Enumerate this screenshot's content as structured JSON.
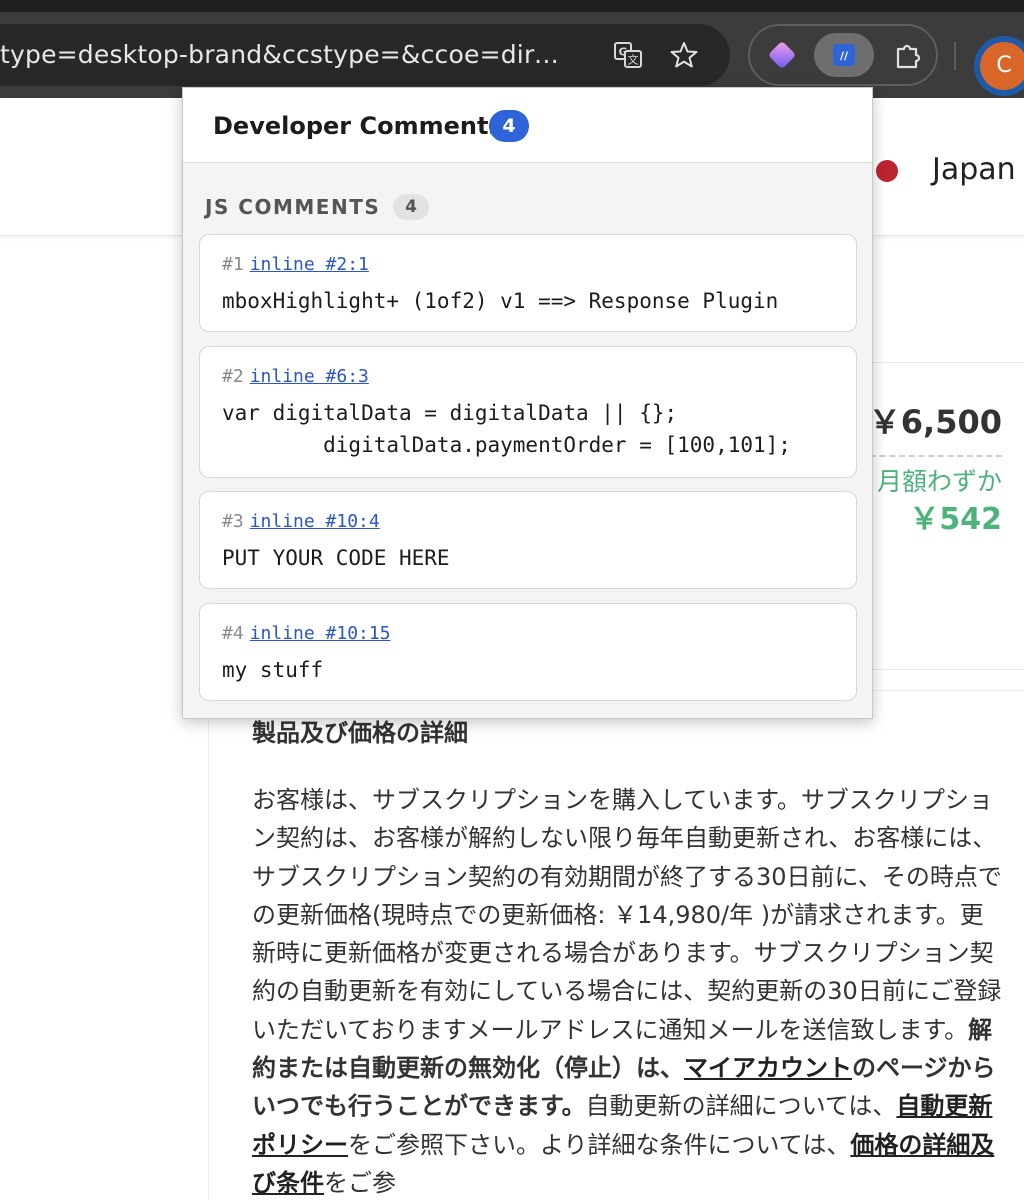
{
  "browser": {
    "url": "type=desktop-brand&ccstype=&ccoe=direct&c...",
    "translate_icon": "translate-icon",
    "bookmark_icon": "star-icon",
    "extensions": [
      {
        "name": "gradient-diamond-extension-icon"
      },
      {
        "name": "developer-comments-extension-icon"
      },
      {
        "name": "puzzle-icon"
      }
    ],
    "profile_initial": "C"
  },
  "page": {
    "country": "Japan",
    "price": "￥6,500",
    "monthly_label": "月額わずか",
    "monthly_price": "￥542",
    "details_title": "製品及び価格の詳細",
    "details_text_1": "お客様は、サブスクリプションを購入しています。サブスクリプション契約は、お客様が解約しない限り毎年自動更新され、お客様には、サブスクリプション契約の有効期間が終了する30日前に、その時点での更新価格(現時点での更新価格: ￥14,980/年 )が請求されます。更新時に更新価格が変更される場合があります。サブスクリプション契約の自動更新を有効にしている場合には、契約更新の30日前にご登録いただいておりますメールアドレスに通知メールを送信致します。",
    "details_bold_1": "解約または自動更新の無効化（停止）は、",
    "details_link_account": "マイアカウント",
    "details_bold_2": "のページからいつでも行うことができます。",
    "details_text_2": "自動更新の詳細については、",
    "details_link_policy": "自動更新ポリシー",
    "details_text_3": "をご参照下さい。より詳細な条件については、",
    "details_link_terms": "価格の詳細及び条件",
    "details_text_4": "をご参"
  },
  "popup": {
    "title": "Developer Comments",
    "total_count": "4",
    "section_label": "JS COMMENTS",
    "section_count": "4",
    "comments": [
      {
        "num": "#1",
        "location": "inline #2:1",
        "code": "mboxHighlight+ (1of2) v1 ==> Response Plugin"
      },
      {
        "num": "#2",
        "location": "inline #6:3",
        "code": "var digitalData = digitalData || {};\n        digitalData.paymentOrder = [100,101];"
      },
      {
        "num": "#3",
        "location": "inline #10:4",
        "code": "PUT YOUR CODE HERE"
      },
      {
        "num": "#4",
        "location": "inline #10:15",
        "code": "my stuff"
      }
    ]
  },
  "colors": {
    "accent_blue": "#2f63d8",
    "price_green": "#4db37a",
    "toolbar_dark": "#3c3c3c"
  }
}
